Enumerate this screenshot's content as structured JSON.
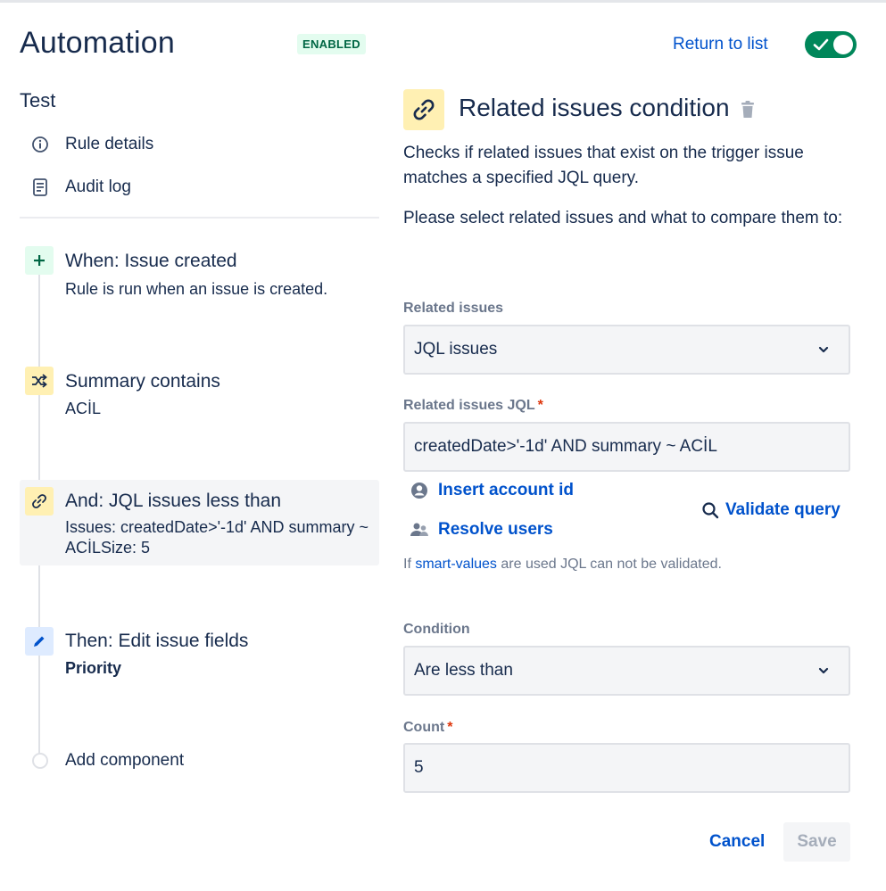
{
  "header": {
    "title": "Automation",
    "status_badge": "ENABLED",
    "return_link": "Return to list",
    "toggle_on": true
  },
  "sidebar": {
    "rule_name": "Test",
    "nav": [
      {
        "label": "Rule details",
        "icon": "info-icon"
      },
      {
        "label": "Audit log",
        "icon": "document-icon"
      }
    ],
    "steps": [
      {
        "title": "When: Issue created",
        "description": "Rule is run when an issue is created.",
        "icon": "plus-icon"
      },
      {
        "title": "Summary contains",
        "description": "ACİL",
        "icon": "shuffle-icon"
      },
      {
        "title": "And: JQL issues less than",
        "description": "Issues: createdDate>'-1d' AND summary ~ ACİLSize: 5",
        "icon": "link-icon"
      },
      {
        "title": "Then: Edit issue fields",
        "description": "Priority",
        "icon": "pencil-icon"
      }
    ],
    "add_component": "Add component"
  },
  "panel": {
    "title": "Related issues condition",
    "description": "Checks if related issues that exist on the trigger issue matches a specified JQL query.",
    "instruction": "Please select related issues and what to compare them to:",
    "related_issues": {
      "label": "Related issues",
      "value": "JQL issues"
    },
    "related_jql": {
      "label": "Related issues JQL",
      "required_mark": "*",
      "value": "createdDate>'-1d' AND summary ~ ACİL"
    },
    "insert_account_id": "Insert account id",
    "resolve_users": "Resolve users",
    "validate_query": "Validate query",
    "hint_prefix": "If",
    "hint_link": "smart-values",
    "hint_suffix": "are used JQL can not be validated.",
    "condition": {
      "label": "Condition",
      "value": "Are less than"
    },
    "count": {
      "label": "Count",
      "required_mark": "*",
      "value": "5"
    },
    "cancel": "Cancel",
    "save": "Save"
  },
  "colors": {
    "primary_text": "#172b4d",
    "link": "#0052cc",
    "enabled_green": "#00875a",
    "badge_bg": "#e3fcef",
    "trigger_icon_bg": "#e3fcef",
    "condition_icon_bg": "#fff0b3",
    "action_icon_bg": "#deebff",
    "required": "#de350b"
  }
}
